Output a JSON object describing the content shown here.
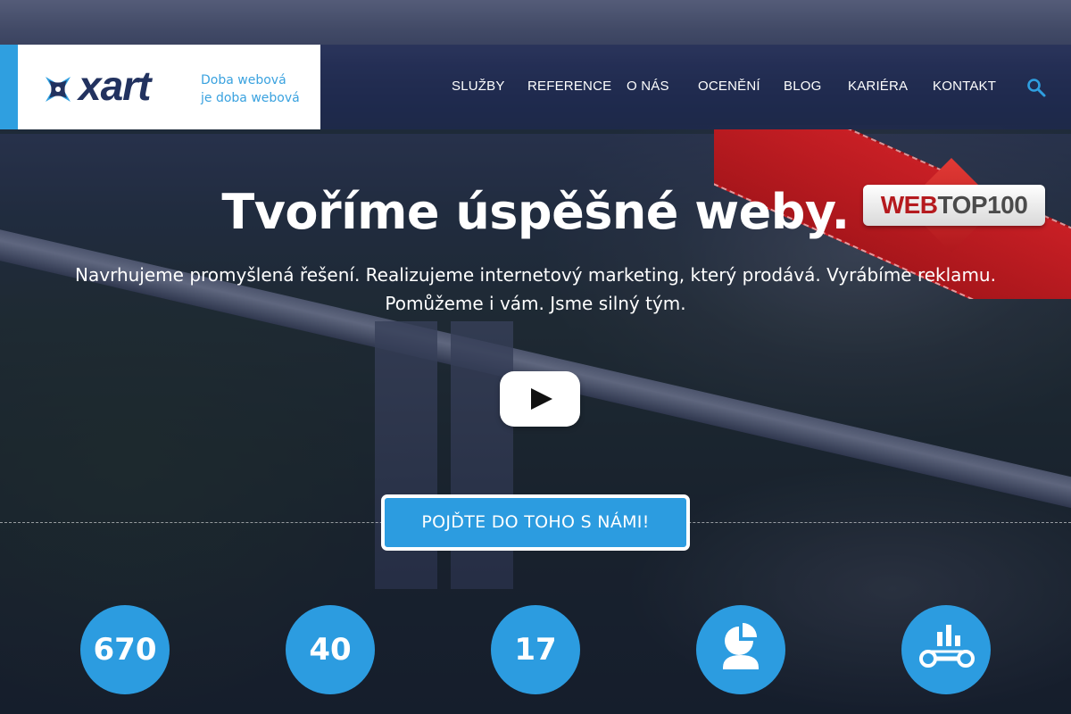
{
  "brand": {
    "logo_text": "xart",
    "tagline_line1": "Doba webová",
    "tagline_line2": "je doba webová",
    "accent_color": "#2f9fe0",
    "logo_color": "#22325f"
  },
  "nav": {
    "items": [
      {
        "label": "SLUŽBY"
      },
      {
        "label": "REFERENCE"
      },
      {
        "label": "O NÁS"
      },
      {
        "label": "OCENĚNÍ"
      },
      {
        "label": "BLOG"
      },
      {
        "label": "KARIÉRA"
      },
      {
        "label": "KONTAKT"
      }
    ],
    "search_icon": "search-icon"
  },
  "badge": {
    "part1": "WEB",
    "part2": "TOP100",
    "color": "#b51a1e"
  },
  "hero": {
    "title": "Tvoříme úspěšné weby.",
    "subtitle_line1": "Navrhujeme promyšlená řešení. Realizujeme internetový marketing, který prodává. Vyrábíme reklamu.",
    "subtitle_line2": "Pomůžeme i vám. Jsme silný tým.",
    "play_icon": "play-icon"
  },
  "cta": {
    "label": "POJĎTE DO TOHO S NÁMI!",
    "color": "#2c9ce0"
  },
  "stats": [
    {
      "number": "670",
      "label": "…"
    },
    {
      "number": "40",
      "label": "…"
    },
    {
      "number": "17",
      "label": "…"
    },
    {
      "icon": "team-chart-icon",
      "label": "…"
    },
    {
      "icon": "analytics-icon",
      "label": "…"
    }
  ]
}
